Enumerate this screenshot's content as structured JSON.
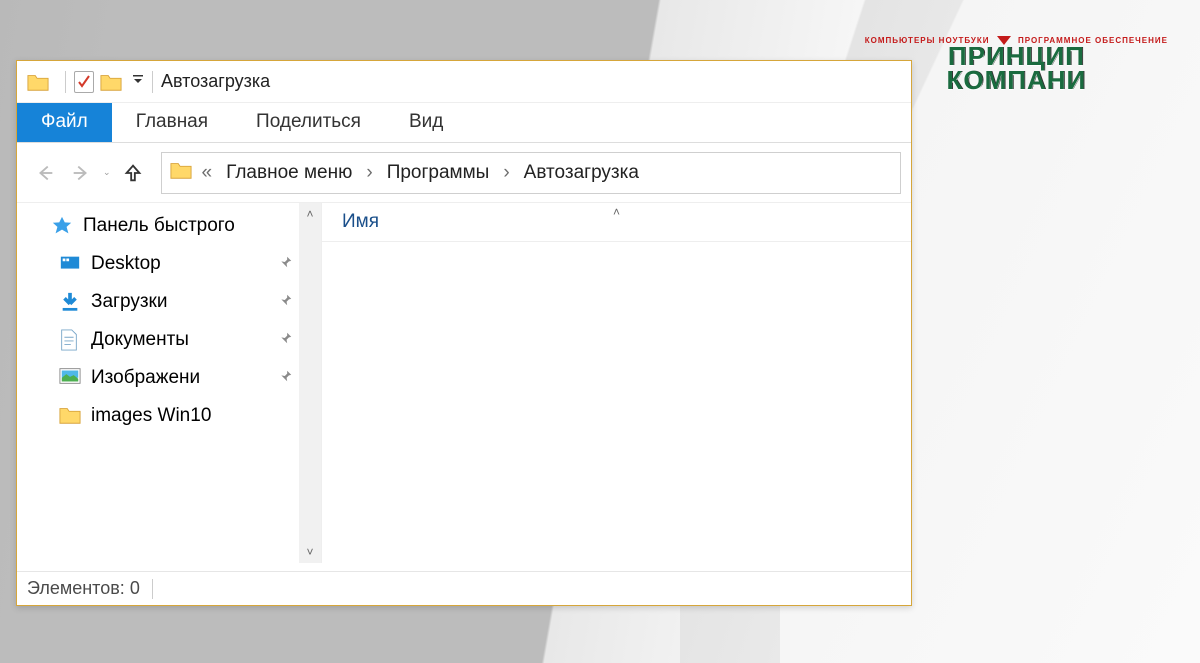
{
  "window": {
    "title": "Автозагрузка"
  },
  "ribbon": {
    "file": "Файл",
    "tabs": [
      "Главная",
      "Поделиться",
      "Вид"
    ]
  },
  "breadcrumb": {
    "overflow": "«",
    "items": [
      "Главное меню",
      "Программы",
      "Автозагрузка"
    ]
  },
  "sidebar": {
    "quick_access": "Панель быстрого",
    "items": [
      {
        "label": "Desktop",
        "icon": "desktop"
      },
      {
        "label": "Загрузки",
        "icon": "download"
      },
      {
        "label": "Документы",
        "icon": "document"
      },
      {
        "label": "Изображени",
        "icon": "picture"
      },
      {
        "label": "images Win10",
        "icon": "folder"
      }
    ]
  },
  "columns": {
    "name": "Имя"
  },
  "status": {
    "items_label": "Элементов:",
    "count": "0"
  },
  "brand": {
    "top_left": "КОМПЬЮТЕРЫ  НОУТБУКИ",
    "top_right": "ПРОГРАММНОЕ ОБЕСПЕЧЕНИЕ",
    "line1": "ПРИНЦИП",
    "line2": "КОМПАНИ"
  }
}
